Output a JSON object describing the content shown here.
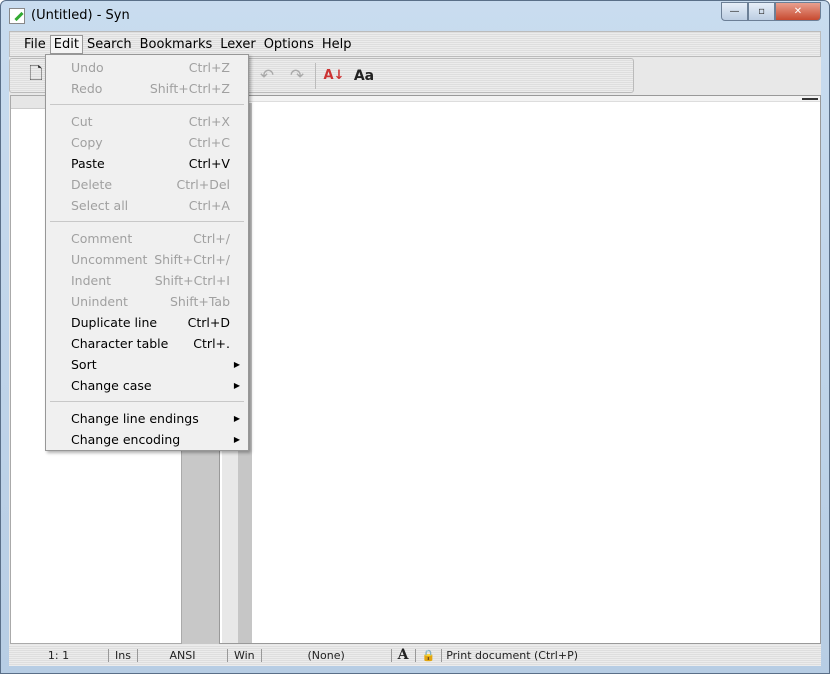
{
  "window": {
    "title": "(Untitled) - Syn",
    "minimize": "—",
    "maximize": "▫",
    "close": "✕"
  },
  "menubar": [
    "File",
    "Edit",
    "Search",
    "Bookmarks",
    "Lexer",
    "Options",
    "Help"
  ],
  "edit_menu": [
    {
      "label": "Undo",
      "shortcut": "Ctrl+Z",
      "enabled": false
    },
    {
      "label": "Redo",
      "shortcut": "Shift+Ctrl+Z",
      "enabled": false
    },
    {
      "sep": true
    },
    {
      "label": "Cut",
      "shortcut": "Ctrl+X",
      "enabled": false
    },
    {
      "label": "Copy",
      "shortcut": "Ctrl+C",
      "enabled": false
    },
    {
      "label": "Paste",
      "shortcut": "Ctrl+V",
      "enabled": true
    },
    {
      "label": "Delete",
      "shortcut": "Ctrl+Del",
      "enabled": false
    },
    {
      "label": "Select all",
      "shortcut": "Ctrl+A",
      "enabled": false
    },
    {
      "sep": true
    },
    {
      "label": "Comment",
      "shortcut": "Ctrl+/",
      "enabled": false
    },
    {
      "label": "Uncomment",
      "shortcut": "Shift+Ctrl+/",
      "enabled": false
    },
    {
      "label": "Indent",
      "shortcut": "Shift+Ctrl+I",
      "enabled": false
    },
    {
      "label": "Unindent",
      "shortcut": "Shift+Tab",
      "enabled": false
    },
    {
      "label": "Duplicate line",
      "shortcut": "Ctrl+D",
      "enabled": true
    },
    {
      "label": "Character table",
      "shortcut": "Ctrl+.",
      "enabled": true
    },
    {
      "label": "Sort",
      "submenu": true,
      "enabled": true
    },
    {
      "label": "Change case",
      "submenu": true,
      "enabled": true
    },
    {
      "sep": true
    },
    {
      "label": "Change line endings",
      "submenu": true,
      "enabled": true
    },
    {
      "label": "Change encoding",
      "submenu": true,
      "enabled": true
    }
  ],
  "toolbar": [
    {
      "name": "new-file-icon",
      "glyph": "🗋",
      "on": true
    },
    {
      "name": "tools-icon",
      "glyph": "⚒",
      "on": true
    },
    {
      "name": "copy-icon",
      "glyph": "❐",
      "on": false
    },
    {
      "name": "cut-icon",
      "glyph": "✂",
      "on": false
    },
    {
      "name": "paste-icon",
      "glyph": "📋",
      "on": true
    },
    {
      "name": "delete-icon",
      "glyph": "⊠",
      "on": false
    },
    {
      "name": "properties-icon",
      "glyph": "▤",
      "on": false
    },
    {
      "name": "undo-icon",
      "glyph": "↶",
      "on": false
    },
    {
      "name": "redo-icon",
      "glyph": "↷",
      "on": false
    },
    {
      "name": "sort-az-icon",
      "glyph": "A↓",
      "on": true
    },
    {
      "name": "font-icon",
      "glyph": "Aa",
      "on": true
    }
  ],
  "status": {
    "position": "1: 1",
    "mode": "Ins",
    "encoding": "ANSI",
    "line_endings": "Win",
    "lexer": "(None)",
    "font_glyph": "A",
    "hint": "Print document (Ctrl+P)"
  }
}
